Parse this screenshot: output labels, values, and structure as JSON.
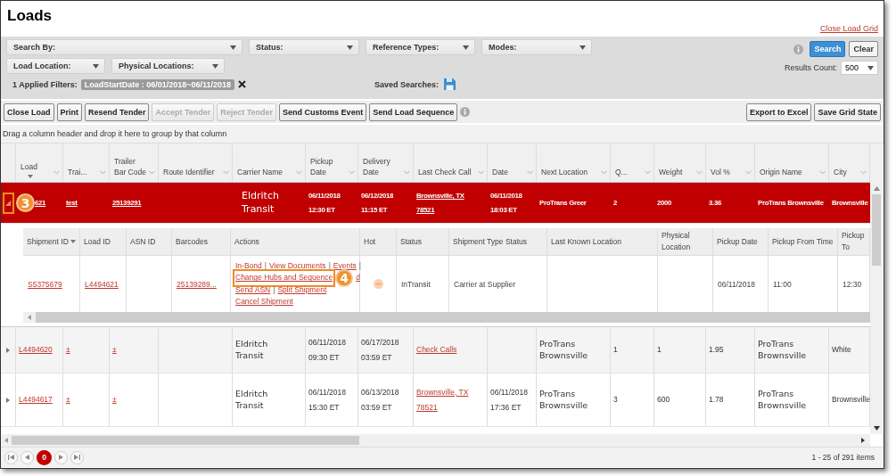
{
  "page": {
    "title": "Loads",
    "close_link": "Close Load Grid"
  },
  "filters": {
    "rows": [
      [
        {
          "label": "Search By:"
        },
        {
          "label": "Status:"
        },
        {
          "label": "Reference Types:"
        },
        {
          "label": "Modes:"
        }
      ],
      [
        {
          "label": "Load Location:"
        },
        {
          "label": "Physical Locations:"
        }
      ]
    ],
    "applied_label": "1 Applied Filters:",
    "applied_chip": "LoadStartDate : 06/01/2018~06/11/2018",
    "saved_label": "Saved Searches:",
    "search_button": "Search",
    "clear_button": "Clear",
    "results_label": "Results Count:",
    "results_value": "500"
  },
  "toolbar": {
    "buttons": [
      {
        "label": "Close Load",
        "disabled": false
      },
      {
        "label": "Print",
        "disabled": false
      },
      {
        "label": "Resend Tender",
        "disabled": false
      },
      {
        "label": "Accept Tender",
        "disabled": true
      },
      {
        "label": "Reject Tender",
        "disabled": true
      },
      {
        "label": "Send Customs Event",
        "disabled": false
      },
      {
        "label": "Send Load Sequence",
        "disabled": false
      }
    ],
    "right_buttons": [
      {
        "label": "Export to Excel",
        "disabled": false
      },
      {
        "label": "Save Grid State",
        "disabled": false
      }
    ]
  },
  "group_hint": "Drag a column header and drop it here to group by that column",
  "grid": {
    "columns": [
      {
        "label": "Load",
        "sorted": true
      },
      {
        "label": "Trai...",
        "sorted": false
      },
      {
        "label": "Trailer Bar Code",
        "sorted": false
      },
      {
        "label": "Route Identifier",
        "sorted": false
      },
      {
        "label": "Carrier Name",
        "sorted": false
      },
      {
        "label": "Pickup Date",
        "sorted": false
      },
      {
        "label": "Delivery Date",
        "sorted": false
      },
      {
        "label": "Last Check Call",
        "sorted": false
      },
      {
        "label": "Date",
        "sorted": false
      },
      {
        "label": "Next Location",
        "sorted": false
      },
      {
        "label": "Q...",
        "sorted": false
      },
      {
        "label": "Weight",
        "sorted": false
      },
      {
        "label": "Vol %",
        "sorted": false
      },
      {
        "label": "Origin Name",
        "sorted": false
      },
      {
        "label": "City",
        "sorted": false
      }
    ],
    "rows": [
      {
        "selected": true,
        "expanded": true,
        "expander_highlighted": true,
        "callout": "3",
        "cells": [
          {
            "kind": "link",
            "lines": [
              "621"
            ]
          },
          {
            "kind": "link",
            "lines": [
              "test"
            ]
          },
          {
            "kind": "link",
            "lines": [
              "25139291"
            ]
          },
          {
            "kind": "empty"
          },
          {
            "kind": "large",
            "lines": [
              "Eldritch",
              "Transit"
            ]
          },
          {
            "kind": "text",
            "lines": [
              "06/11/2018",
              "12:30 ET"
            ]
          },
          {
            "kind": "text",
            "lines": [
              "06/12/2018",
              "11:15 ET"
            ]
          },
          {
            "kind": "link",
            "lines": [
              "Brownsville, TX",
              "78521"
            ]
          },
          {
            "kind": "text",
            "lines": [
              "06/11/2018",
              "18:03 ET"
            ]
          },
          {
            "kind": "text",
            "lines": [
              "ProTrans Greer"
            ]
          },
          {
            "kind": "text",
            "lines": [
              "2"
            ]
          },
          {
            "kind": "text",
            "lines": [
              "2000"
            ]
          },
          {
            "kind": "text",
            "lines": [
              "3.36"
            ]
          },
          {
            "kind": "text",
            "lines": [
              "ProTrans Brownsville"
            ]
          },
          {
            "kind": "text",
            "lines": [
              "Brownsville"
            ]
          }
        ],
        "detail": {
          "columns": [
            {
              "label": "Shipment ID",
              "sorted": true
            },
            {
              "label": "Load ID",
              "sorted": false
            },
            {
              "label": "ASN ID",
              "sorted": false
            },
            {
              "label": "Barcodes",
              "sorted": false
            },
            {
              "label": "Actions",
              "sorted": false
            },
            {
              "label": "Hot",
              "sorted": false
            },
            {
              "label": "Status",
              "sorted": false
            },
            {
              "label": "Shipment Type Status",
              "sorted": false
            },
            {
              "label": "Last Known Location",
              "sorted": false
            },
            {
              "label": "Physical Location",
              "sorted": false
            },
            {
              "label": "Pickup Date",
              "sorted": false
            },
            {
              "label": "Pickup From Time",
              "sorted": false
            },
            {
              "label": "Pickup To",
              "sorted": false
            }
          ],
          "row": {
            "shipment_id": "S5375679",
            "load_id": "L4494621",
            "barcodes": "25139289...",
            "hot": true,
            "actions": [
              [
                {
                  "kind": "link",
                  "text": "In-Bond"
                },
                {
                  "kind": "sep",
                  "text": "|"
                },
                {
                  "kind": "link",
                  "text": "View Documents"
                },
                {
                  "kind": "sep",
                  "text": "|"
                },
                {
                  "kind": "link",
                  "text": "Events"
                },
                {
                  "kind": "sep",
                  "text": "|"
                }
              ],
              [
                {
                  "kind": "link",
                  "text": "Change Hubs and Sequence",
                  "highlighted": true,
                  "callout": "4"
                },
                {
                  "kind": "link",
                  "text": "d"
                }
              ],
              [
                {
                  "kind": "link",
                  "text": "Send ASN"
                },
                {
                  "kind": "sep",
                  "text": "|"
                },
                {
                  "kind": "link",
                  "text": "Split Shipment"
                }
              ],
              [
                {
                  "kind": "link",
                  "text": "Cancel Shipment"
                }
              ]
            ],
            "status": "InTransit",
            "shipment_type_status": "Carrier at Supplier",
            "pickup_date": "06/11/2018",
            "pickup_from": "11:00",
            "pickup_to": "12:30"
          }
        }
      },
      {
        "selected": false,
        "expanded": false,
        "expander_highlighted": false,
        "cells": [
          {
            "kind": "link",
            "lines": [
              "L4494620"
            ]
          },
          {
            "kind": "link",
            "lines": [
              "±"
            ]
          },
          {
            "kind": "link",
            "lines": [
              "±"
            ]
          },
          {
            "kind": "empty"
          },
          {
            "kind": "large",
            "lines": [
              "Eldritch",
              "Transit"
            ]
          },
          {
            "kind": "text",
            "lines": [
              "06/11/2018",
              "09:30 ET"
            ]
          },
          {
            "kind": "text",
            "lines": [
              "06/17/2018",
              "03:59 ET"
            ]
          },
          {
            "kind": "link",
            "lines": [
              "Check Calls"
            ]
          },
          {
            "kind": "empty"
          },
          {
            "kind": "large",
            "lines": [
              "ProTrans",
              "Brownsville"
            ]
          },
          {
            "kind": "text",
            "lines": [
              "1"
            ]
          },
          {
            "kind": "text",
            "lines": [
              "1"
            ]
          },
          {
            "kind": "text",
            "lines": [
              "1.95"
            ]
          },
          {
            "kind": "large",
            "lines": [
              "ProTrans",
              "Brownsville"
            ]
          },
          {
            "kind": "text",
            "lines": [
              "White"
            ]
          }
        ]
      },
      {
        "selected": false,
        "expanded": false,
        "expander_highlighted": false,
        "cells": [
          {
            "kind": "link",
            "lines": [
              "L4494617"
            ]
          },
          {
            "kind": "link",
            "lines": [
              "±"
            ]
          },
          {
            "kind": "link",
            "lines": [
              "±"
            ]
          },
          {
            "kind": "empty"
          },
          {
            "kind": "large",
            "lines": [
              "Eldritch",
              "Transit"
            ]
          },
          {
            "kind": "text",
            "lines": [
              "06/11/2018",
              "15:30 ET"
            ]
          },
          {
            "kind": "text",
            "lines": [
              "06/13/2018",
              "03:59 ET"
            ]
          },
          {
            "kind": "link",
            "lines": [
              "Brownsville, TX",
              "78521"
            ]
          },
          {
            "kind": "text",
            "lines": [
              "06/11/2018",
              "17:36 ET"
            ]
          },
          {
            "kind": "large",
            "lines": [
              "ProTrans",
              "Brownsville"
            ]
          },
          {
            "kind": "text",
            "lines": [
              "3"
            ]
          },
          {
            "kind": "text",
            "lines": [
              "600"
            ]
          },
          {
            "kind": "text",
            "lines": [
              "1.78"
            ]
          },
          {
            "kind": "large",
            "lines": [
              "ProTrans",
              "Brownsville"
            ]
          },
          {
            "kind": "text",
            "lines": [
              "Brownsville"
            ]
          }
        ]
      }
    ]
  },
  "pager": {
    "pages": [
      {
        "label": "0",
        "selected": true
      }
    ],
    "summary": "1 - 25 of 291 items"
  }
}
